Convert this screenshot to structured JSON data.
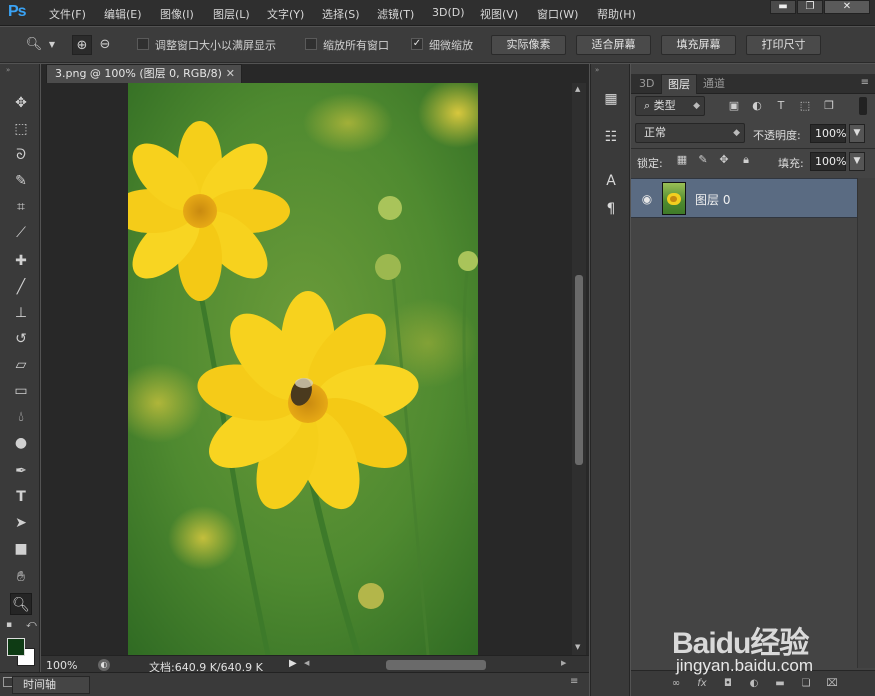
{
  "app": {
    "logo": "Ps"
  },
  "menu": [
    "文件(F)",
    "编辑(E)",
    "图像(I)",
    "图层(L)",
    "文字(Y)",
    "选择(S)",
    "滤镜(T)",
    "3D(D)",
    "视图(V)",
    "窗口(W)",
    "帮助(H)"
  ],
  "window_controls": {
    "minimize": "▬",
    "maximize": "❐",
    "close": "✕"
  },
  "options": {
    "resize_windows": {
      "label": "调整窗口大小以满屏显示",
      "checked": false
    },
    "zoom_all": {
      "label": "缩放所有窗口",
      "checked": false
    },
    "scrubby_zoom": {
      "label": "细微缩放",
      "checked": true
    },
    "buttons": [
      "实际像素",
      "适合屏幕",
      "填充屏幕",
      "打印尺寸"
    ]
  },
  "document": {
    "tab_title": "3.png @ 100% (图层 0, RGB/8)",
    "zoom": "100%",
    "doc_info": "文档:640.9 K/640.9 K"
  },
  "timeline": {
    "label": "时间轴"
  },
  "colors": {
    "foreground": "#0e3b14",
    "background": "#ffffff",
    "layer_selected": "#5a6b82",
    "ps_blue": "#3aa3f5"
  },
  "panel_tabs": [
    "3D",
    "图层",
    "通道"
  ],
  "layers_panel": {
    "filter": "类型",
    "blend_mode": "正常",
    "opacity_label": "不透明度:",
    "opacity_value": "100%",
    "lock_label": "锁定:",
    "fill_label": "填充:",
    "fill_value": "100%",
    "layers": [
      {
        "name": "图层 0",
        "visible": true
      }
    ]
  },
  "dock_icons": [
    "history-icon",
    "brush-presets-icon",
    "character-icon",
    "paragraph-icon"
  ],
  "watermark": {
    "brand": "Baidu经验",
    "url": "jingyan.baidu.com"
  }
}
